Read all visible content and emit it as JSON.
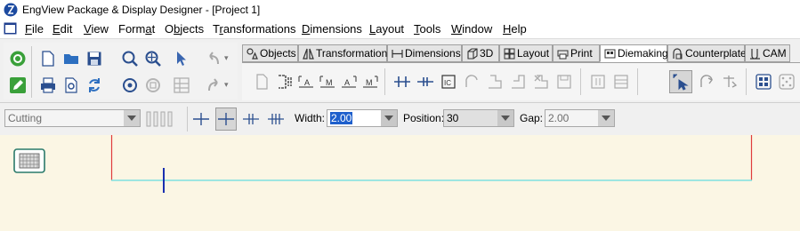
{
  "window": {
    "title": "EngView Package & Display Designer - [Project 1]"
  },
  "menu": [
    {
      "label": "File",
      "u": "F",
      "rest": "ile"
    },
    {
      "label": "Edit",
      "u": "E",
      "rest": "dit"
    },
    {
      "label": "View",
      "u": "V",
      "rest": "iew"
    },
    {
      "label": "Format",
      "pre": "Form",
      "u": "a",
      "rest": "t"
    },
    {
      "label": "Objects",
      "pre": "O",
      "u": "b",
      "rest": "jects"
    },
    {
      "label": "Transformations",
      "pre": "T",
      "u": "r",
      "rest": "ansformations"
    },
    {
      "label": "Dimensions",
      "u": "D",
      "rest": "imensions"
    },
    {
      "label": "Layout",
      "u": "L",
      "rest": "ayout"
    },
    {
      "label": "Tools",
      "u": "T",
      "rest": "ools"
    },
    {
      "label": "Window",
      "u": "W",
      "rest": "indow"
    },
    {
      "label": "Help",
      "u": "H",
      "rest": "elp"
    }
  ],
  "tabs": [
    {
      "label": "Objects",
      "icon": "objects-icon"
    },
    {
      "label": "Transformations",
      "icon": "transformations-icon"
    },
    {
      "label": "Dimensions",
      "icon": "dimensions-icon"
    },
    {
      "label": "3D",
      "icon": "cube-icon"
    },
    {
      "label": "Layout",
      "icon": "layout-icon"
    },
    {
      "label": "Print",
      "icon": "print-icon"
    },
    {
      "label": "Diemaking",
      "icon": "diemaking-icon",
      "active": true
    },
    {
      "label": "Counterplate",
      "icon": "counterplate-icon"
    },
    {
      "label": "CAM",
      "icon": "cam-icon"
    }
  ],
  "properties": {
    "line_type": "Cutting",
    "width_label": "Width:",
    "width_value": "2.00",
    "position_label": "Position:",
    "position_value": "30",
    "gap_label": "Gap:",
    "gap_value": "2.00"
  },
  "colors": {
    "canvas_bg": "#fbf6e4",
    "red_line": "#e03c3c",
    "cyan_line": "#7fe0e0",
    "blue_cursor": "#1a2fb0",
    "tab_active_bg": "#ffffff"
  }
}
